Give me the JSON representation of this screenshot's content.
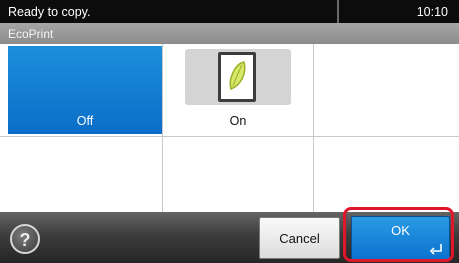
{
  "status_bar": {
    "message": "Ready to copy.",
    "time": "10:10"
  },
  "title_bar": {
    "title": "EcoPrint"
  },
  "options": [
    {
      "label": "Off",
      "selected": true
    },
    {
      "label": "On",
      "selected": false,
      "icon": "ecoprint-icon"
    }
  ],
  "bottom_bar": {
    "help_icon": "question-mark-icon",
    "help_glyph": "?",
    "cancel_label": "Cancel",
    "ok_label": "OK",
    "ok_icon": "enter-icon"
  },
  "colors": {
    "selected_option": "#0a6ec8",
    "ok_button": "#0b73cf",
    "highlight_frame": "#e0162b"
  }
}
